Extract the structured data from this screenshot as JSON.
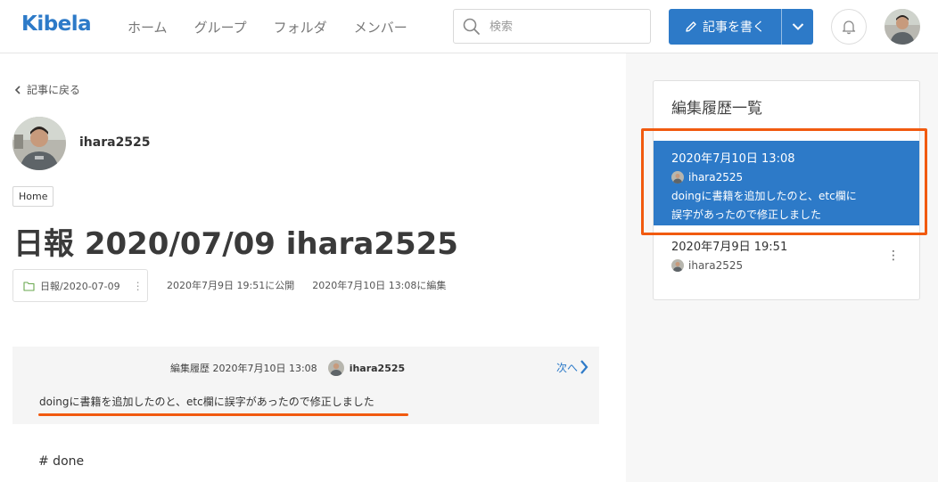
{
  "header": {
    "logo": "Kibela",
    "nav": [
      "ホーム",
      "グループ",
      "フォルダ",
      "メンバー"
    ],
    "search_placeholder": "検索",
    "write_label": "記事を書く"
  },
  "article": {
    "back_label": "記事に戻る",
    "author": "ihara2525",
    "group_tag": "Home",
    "title": "日報 2020/07/09 ihara2525",
    "folder": "日報/2020-07-09",
    "published": "2020年7月9日 19:51に公開",
    "edited": "2020年7月10日 13:08に編集",
    "diff": {
      "label": "編集履歴 2020年7月10日 13:08",
      "user": "ihara2525",
      "next_label": "次へ",
      "message": "doingに書籍を追加したのと、etc欄に誤字があったので修正しました"
    },
    "body_first_line": "# done"
  },
  "sidebar": {
    "title": "編集履歴一覧",
    "items": [
      {
        "date": "2020年7月10日 13:08",
        "user": "ihara2525",
        "note_line1": "doingに書籍を追加したのと、etc欄に",
        "note_line2": "誤字があったので修正しました"
      },
      {
        "date": "2020年7月9日 19:51",
        "user": "ihara2525"
      }
    ]
  },
  "colors": {
    "brand": "#2d7ac8",
    "highlight": "#f15a0f"
  }
}
